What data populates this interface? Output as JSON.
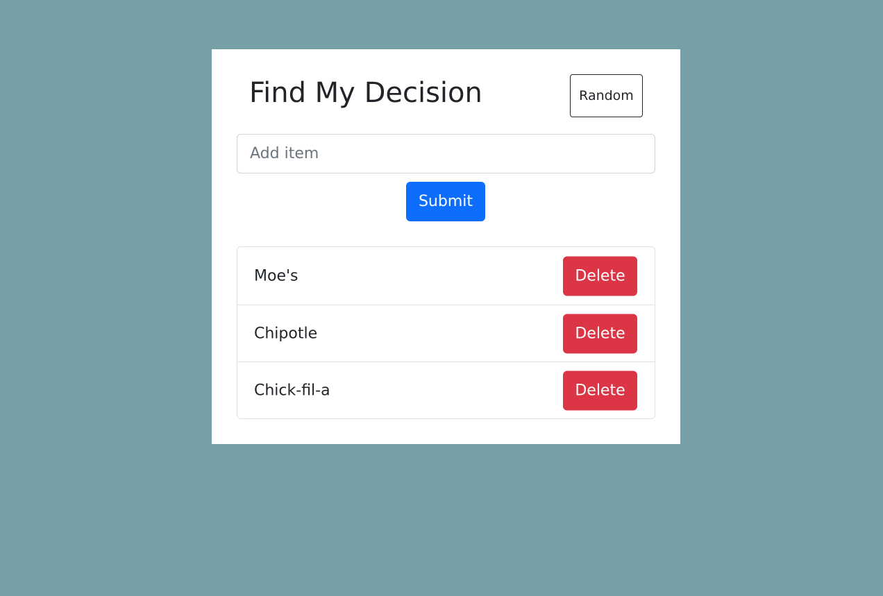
{
  "header": {
    "title": "Find My Decision",
    "random_label": "Random"
  },
  "form": {
    "placeholder": "Add item",
    "value": "",
    "submit_label": "Submit"
  },
  "items": [
    {
      "label": "Moe's",
      "delete_label": "Delete"
    },
    {
      "label": "Chipotle",
      "delete_label": "Delete"
    },
    {
      "label": "Chick-fil-a",
      "delete_label": "Delete"
    }
  ],
  "colors": {
    "page_background": "#76a0a6",
    "card_background": "#ffffff",
    "primary": "#0d6efd",
    "danger": "#dc3545",
    "text": "#212529"
  }
}
